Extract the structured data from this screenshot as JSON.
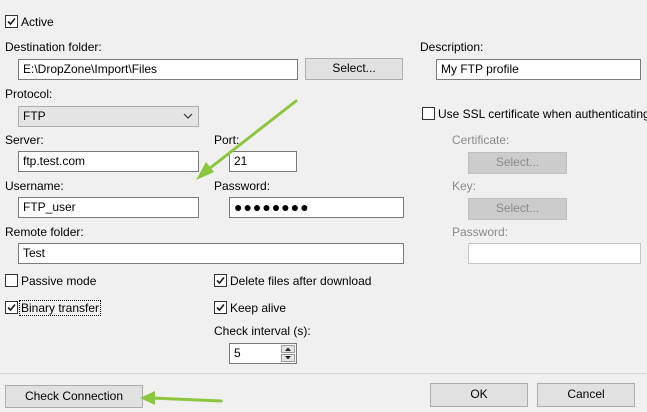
{
  "active": {
    "label": "Active",
    "checked": true
  },
  "destination": {
    "label": "Destination folder:",
    "value": "E:\\DropZone\\Import\\Files",
    "select_label": "Select..."
  },
  "description": {
    "label": "Description:",
    "value": "My FTP profile"
  },
  "protocol": {
    "label": "Protocol:",
    "value": "FTP"
  },
  "ssl": {
    "label": "Use SSL certificate when authenticating",
    "checked": false
  },
  "server": {
    "label": "Server:",
    "value": "ftp.test.com"
  },
  "port": {
    "label": "Port:",
    "value": "21"
  },
  "certificate": {
    "label": "Certificate:",
    "select_label": "Select..."
  },
  "username": {
    "label": "Username:",
    "value": "FTP_user"
  },
  "password": {
    "label": "Password:",
    "value": "●●●●●●●●"
  },
  "key": {
    "label": "Key:",
    "select_label": "Select..."
  },
  "remote_folder": {
    "label": "Remote folder:",
    "value": "Test"
  },
  "key_password": {
    "label": "Password:",
    "value": ""
  },
  "passive": {
    "label": "Passive mode",
    "checked": false
  },
  "delete_files": {
    "label": "Delete files after download",
    "checked": true
  },
  "binary": {
    "label": "Binary transfer",
    "checked": true
  },
  "keep_alive": {
    "label": "Keep alive",
    "checked": true
  },
  "check_interval": {
    "label": "Check interval (s):",
    "value": "5"
  },
  "buttons": {
    "check_connection": "Check Connection",
    "ok": "OK",
    "cancel": "Cancel"
  },
  "colors": {
    "arrow": "#8cc63f",
    "checkmark": "#1a1a1a"
  }
}
